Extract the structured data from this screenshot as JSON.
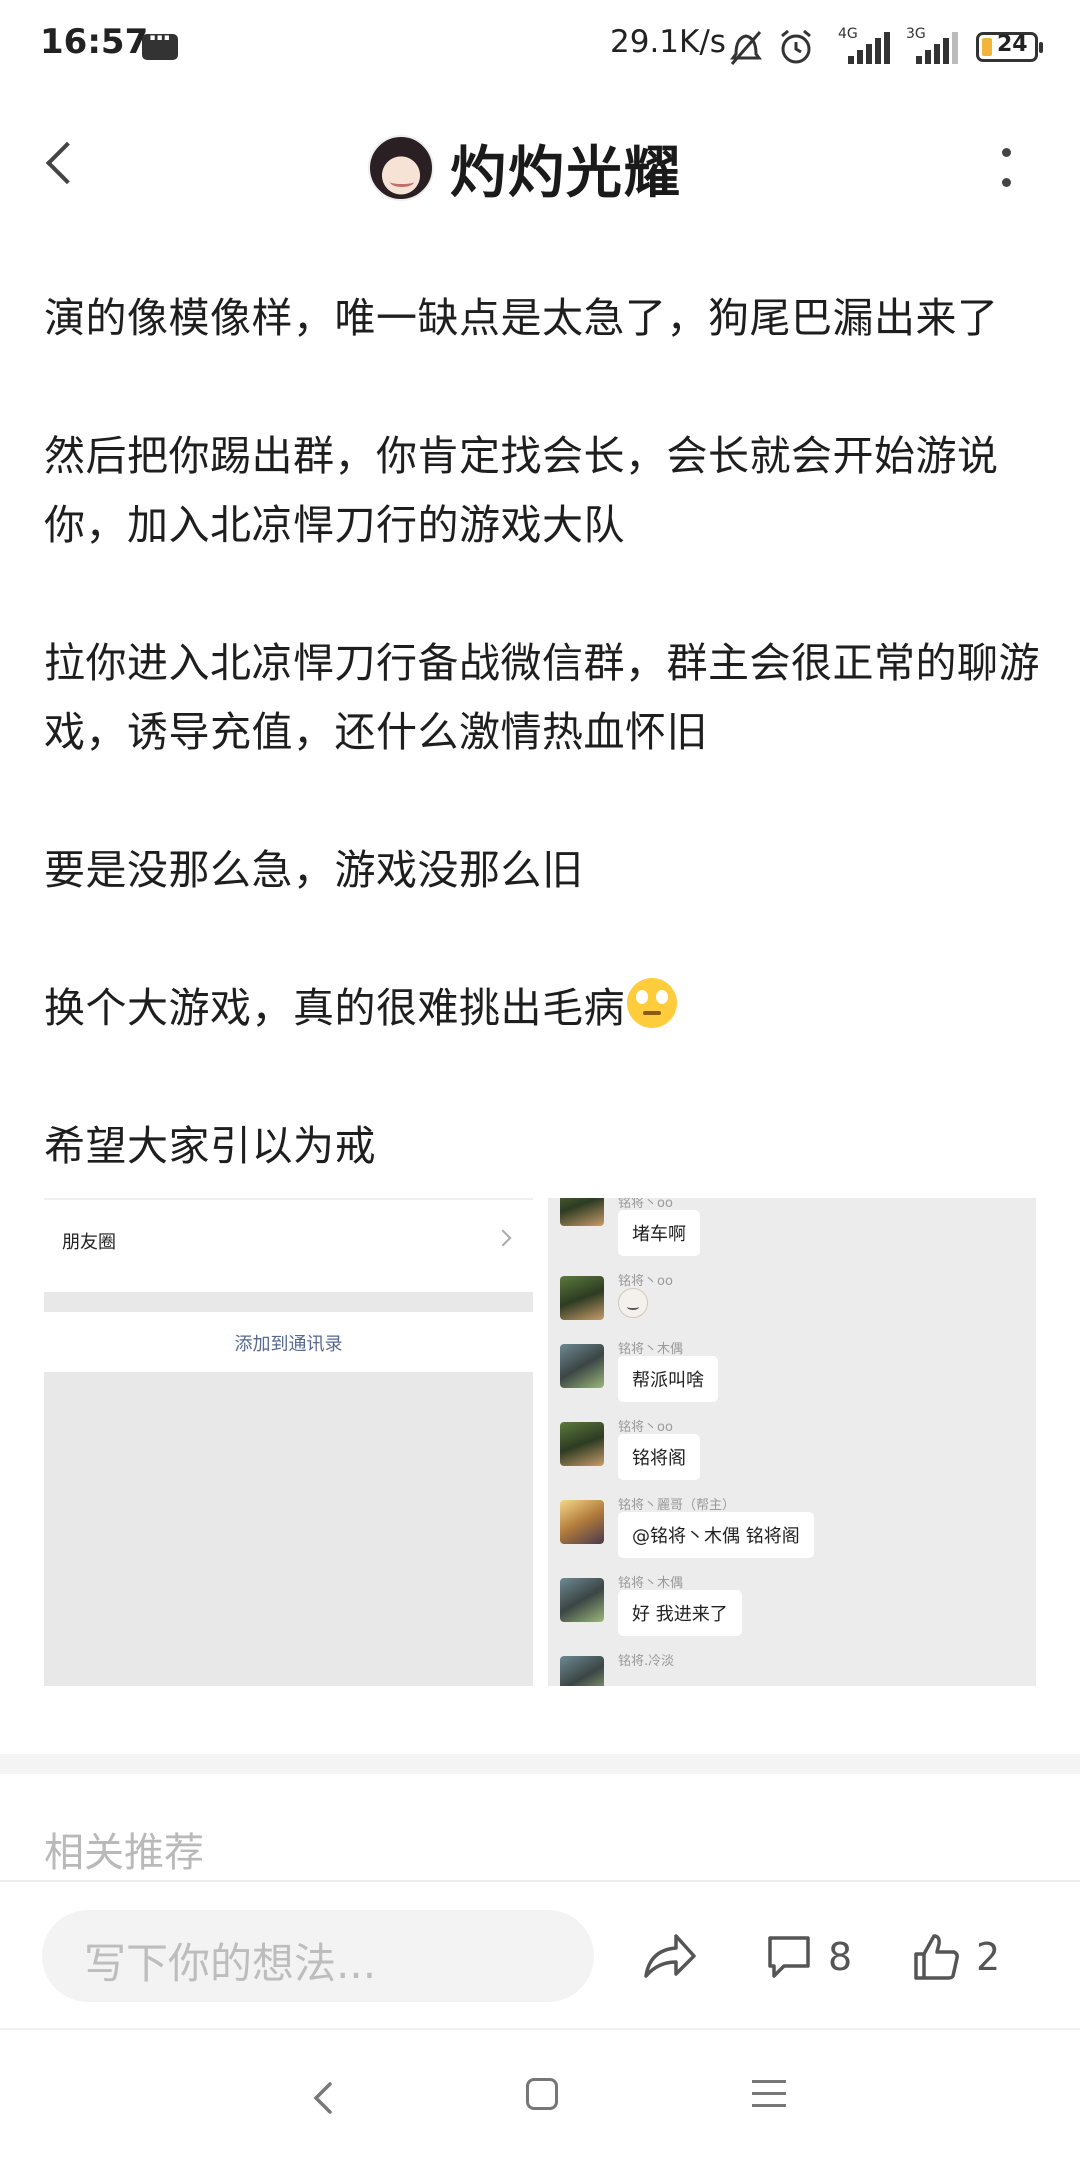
{
  "status_bar": {
    "time": "16:57",
    "net_speed": "29.1K/s",
    "net1": "4G",
    "net2": "3G",
    "battery": "24",
    "icons": [
      "message-icon",
      "mute-icon",
      "alarm-icon",
      "signal-icon",
      "battery-icon"
    ]
  },
  "header": {
    "author_name": "灼灼光耀"
  },
  "post": {
    "paragraphs": [
      "演的像模像样，唯一缺点是太急了，狗尾巴漏出来了",
      "然后把你踢出群，你肯定找会长，会长就会开始游说你，加入北凉悍刀行的游戏大队",
      "拉你进入北凉悍刀行备战微信群，群主会很正常的聊游戏，诱导充值，还什么激情热血怀旧",
      "要是没那么急，游戏没那么旧",
      "换个大游戏，真的很难挑出毛病",
      "希望大家引以为戒"
    ]
  },
  "images": {
    "left": {
      "moments_label": "朋友圈",
      "add_contact_label": "添加到通讯录"
    },
    "right": {
      "messages": [
        {
          "nick": "铭将丶oo",
          "text": "堵车啊"
        },
        {
          "nick": "铭将丶oo",
          "text": ""
        },
        {
          "nick": "铭将丶木偶",
          "text": "帮派叫啥"
        },
        {
          "nick": "铭将丶oo",
          "text": "铭将阁"
        },
        {
          "nick": "铭将丶麗哥（帮主）",
          "text": "@铭将丶木偶  铭将阁"
        },
        {
          "nick": "铭将丶木偶",
          "text": "好 我进来了"
        },
        {
          "nick": "铭将.冷淡",
          "text": ""
        }
      ]
    }
  },
  "related": {
    "title": "相关推荐"
  },
  "action_bar": {
    "input_placeholder": "写下你的想法...",
    "comment_count": "8",
    "like_count": "2"
  }
}
